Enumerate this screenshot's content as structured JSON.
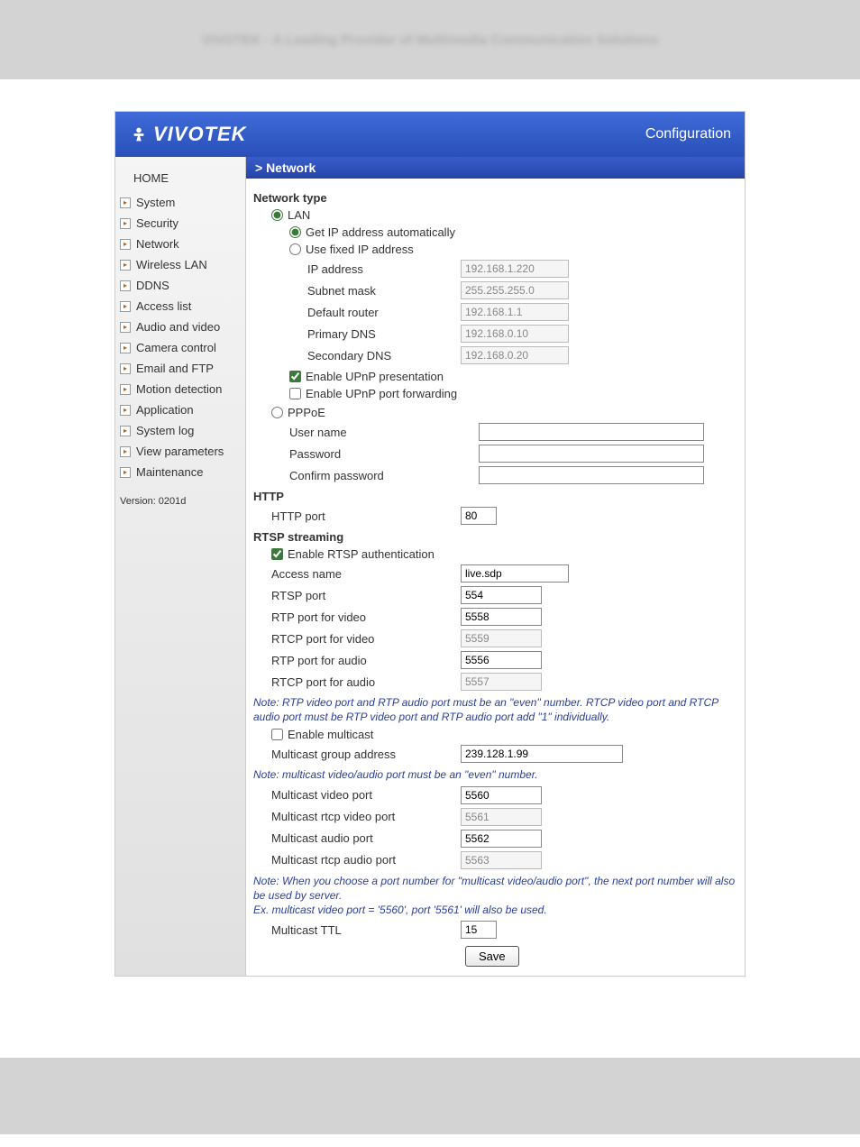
{
  "top_blur": "VIVOTEK - A Leading Provider of Multimedia Communication Solutions",
  "logo": "VIVOTEK",
  "config_label": "Configuration",
  "section_bar": "> Network",
  "sidebar": {
    "home": "HOME",
    "items": [
      "System",
      "Security",
      "Network",
      "Wireless LAN",
      "DDNS",
      "Access list",
      "Audio and video",
      "Camera control",
      "Email and FTP",
      "Motion detection",
      "Application",
      "System log",
      "View parameters",
      "Maintenance"
    ],
    "version": "Version: 0201d"
  },
  "network_type": {
    "title": "Network type",
    "lan": "LAN",
    "auto": "Get IP address automatically",
    "fixed": "Use fixed IP address",
    "ip_label": "IP address",
    "ip_value": "192.168.1.220",
    "subnet_label": "Subnet mask",
    "subnet_value": "255.255.255.0",
    "router_label": "Default router",
    "router_value": "192.168.1.1",
    "pdns_label": "Primary DNS",
    "pdns_value": "192.168.0.10",
    "sdns_label": "Secondary DNS",
    "sdns_value": "192.168.0.20",
    "upnp_pres": "Enable UPnP presentation",
    "upnp_port": "Enable UPnP port forwarding",
    "pppoe": "PPPoE",
    "user_label": "User name",
    "pass_label": "Password",
    "conf_label": "Confirm password"
  },
  "http": {
    "title": "HTTP",
    "port_label": "HTTP port",
    "port_value": "80"
  },
  "rtsp": {
    "title": "RTSP streaming",
    "auth": "Enable RTSP authentication",
    "access_label": "Access name",
    "access_value": "live.sdp",
    "rtsp_port_label": "RTSP port",
    "rtsp_port_value": "554",
    "rtp_v_label": "RTP port for video",
    "rtp_v_value": "5558",
    "rtcp_v_label": "RTCP port for video",
    "rtcp_v_value": "5559",
    "rtp_a_label": "RTP port for audio",
    "rtp_a_value": "5556",
    "rtcp_a_label": "RTCP port for audio",
    "rtcp_a_value": "5557",
    "note1": "Note: RTP video port and RTP audio port must be an \"even\" number. RTCP video port and RTCP audio port must be RTP video port and RTP audio port add \"1\" individually.",
    "multicast_enable": "Enable multicast",
    "mgroup_label": "Multicast group address",
    "mgroup_value": "239.128.1.99",
    "note2": "Note: multicast video/audio port must be an \"even\" number.",
    "mvp_label": "Multicast video port",
    "mvp_value": "5560",
    "mrvp_label": "Multicast rtcp video port",
    "mrvp_value": "5561",
    "map_label": "Multicast audio port",
    "map_value": "5562",
    "mrap_label": "Multicast rtcp audio port",
    "mrap_value": "5563",
    "note3": "Note: When you choose a port number for \"multicast video/audio port\", the next port number will also be used by server.\nEx. multicast video port = '5560', port '5561' will also be used.",
    "ttl_label": "Multicast TTL",
    "ttl_value": "15"
  },
  "save": "Save"
}
